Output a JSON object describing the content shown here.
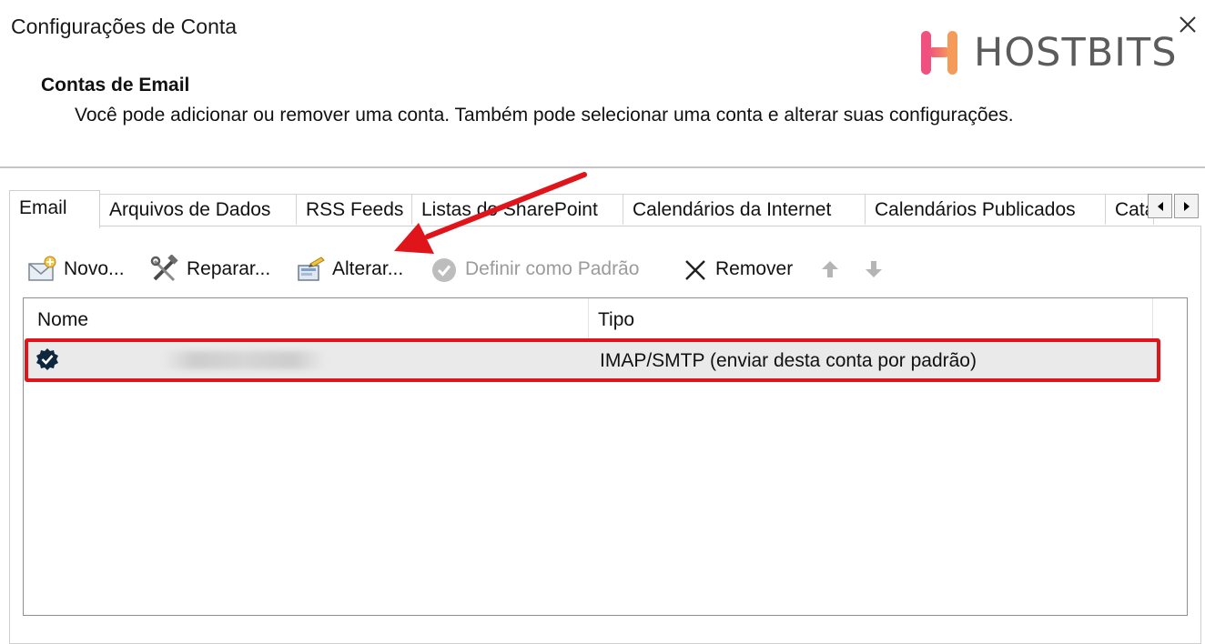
{
  "window": {
    "title": "Configurações de Conta"
  },
  "logo": {
    "text": "HOSTBITS"
  },
  "header": {
    "heading": "Contas de Email",
    "description": "Você pode adicionar ou remover uma conta. Também pode selecionar uma conta e alterar suas configurações."
  },
  "tabs": [
    {
      "label": "Email",
      "active": true
    },
    {
      "label": "Arquivos de Dados"
    },
    {
      "label": "RSS Feeds"
    },
    {
      "label": "Listas do SharePoint"
    },
    {
      "label": "Calendários da Internet"
    },
    {
      "label": "Calendários Publicados"
    },
    {
      "label": "Catálogos de Endereços"
    }
  ],
  "toolbar": {
    "new_label": "Novo...",
    "repair_label": "Reparar...",
    "change_label": "Alterar...",
    "set_default_label": "Definir como Padrão",
    "remove_label": "Remover"
  },
  "list": {
    "columns": [
      "Nome",
      "Tipo"
    ],
    "rows": [
      {
        "type": "IMAP/SMTP (enviar desta conta por padrão)"
      }
    ]
  },
  "colors": {
    "highlight": "#e0151b",
    "logo_pink": "#f0507f",
    "logo_orange": "#f59b5a",
    "logo_text": "#5b5b5b",
    "default_badge": "#10263f"
  },
  "icons": {
    "close": "close-icon",
    "new": "new-email-icon",
    "repair": "repair-tools-icon",
    "change": "change-settings-icon",
    "set_default": "checkmark-circle-icon",
    "remove": "x-remove-icon",
    "move_up": "arrow-up-icon",
    "move_down": "arrow-down-icon",
    "default_account": "default-account-check-icon"
  }
}
